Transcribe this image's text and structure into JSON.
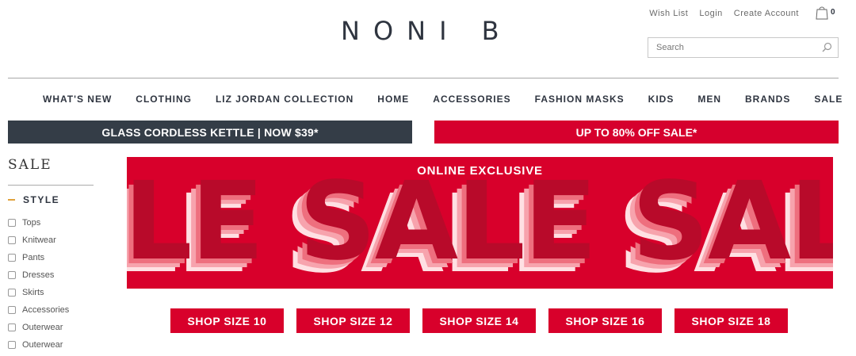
{
  "brand": {
    "logo_text": "NONI B"
  },
  "account": {
    "wishlist": "Wish List",
    "login": "Login",
    "create": "Create Account",
    "cart_count": "0"
  },
  "search": {
    "placeholder": "Search"
  },
  "nav": {
    "items": [
      "WHAT'S NEW",
      "CLOTHING",
      "LIZ JORDAN COLLECTION",
      "HOME",
      "ACCESSORIES",
      "FASHION MASKS",
      "KIDS",
      "MEN",
      "BRANDS",
      "SALE"
    ]
  },
  "promos": {
    "left": "GLASS CORDLESS KETTLE | NOW $39*",
    "right": "UP TO 80% OFF SALE*"
  },
  "sidebar": {
    "title": "SALE",
    "style_heading": "STYLE",
    "filters": [
      "Tops",
      "Knitwear",
      "Pants",
      "Dresses",
      "Skirts",
      "Accessories",
      "Outerwear",
      "Outerwear"
    ]
  },
  "banner": {
    "label": "ONLINE EXCLUSIVE",
    "big_text": "LE SALE SALE SA"
  },
  "size_buttons": [
    "SHOP SIZE 10",
    "SHOP SIZE 12",
    "SHOP SIZE 14",
    "SHOP SIZE 16",
    "SHOP SIZE 18"
  ],
  "colors": {
    "brand_red": "#d8002b",
    "promo_dark": "#343d47",
    "accent_dash": "#e0a23d"
  }
}
